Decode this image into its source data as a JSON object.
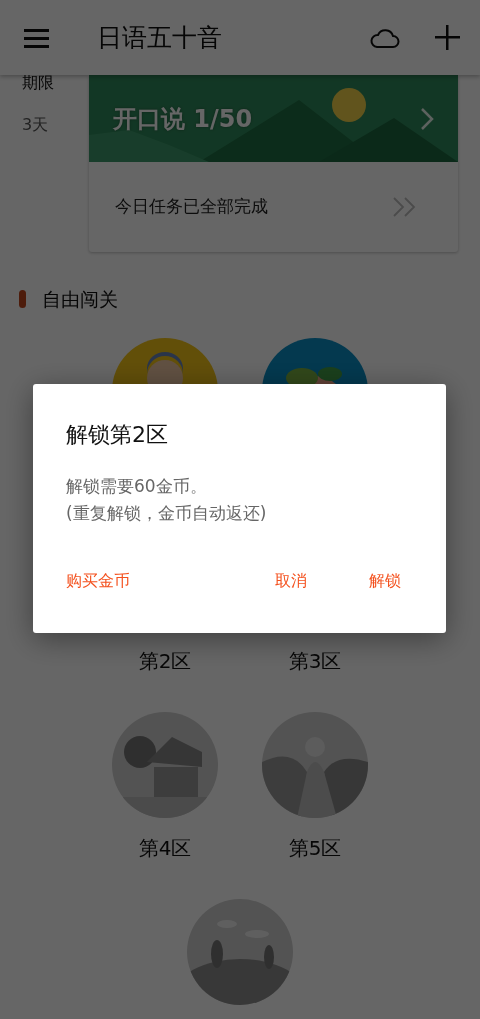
{
  "app_bar": {
    "title": "日语五十音"
  },
  "deadline": {
    "label": "期限",
    "value": "3天"
  },
  "speaking_card": {
    "title": "开口说 1/50",
    "task_status": "今日任务已全部完成"
  },
  "section": {
    "title": "自由闯关"
  },
  "zone_rows": [
    [
      {
        "kind": "portrait"
      },
      {
        "kind": "fruit"
      }
    ],
    [
      {
        "kind": "caption",
        "label": "第2区"
      },
      {
        "kind": "caption",
        "label": "第3区"
      }
    ],
    [
      {
        "kind": "village",
        "label": "第4区"
      },
      {
        "kind": "valley",
        "label": "第5区"
      }
    ],
    [
      {
        "kind": "hills"
      }
    ]
  ],
  "dialog": {
    "title": "解锁第2区",
    "message": [
      "解锁需要60金币。",
      "(重复解锁，金币自动返还)"
    ],
    "buttons": [
      {
        "kind": "left",
        "label": "购买金币"
      },
      {
        "kind": "right",
        "label": "取消"
      },
      {
        "kind": "right",
        "label": "解锁"
      }
    ]
  }
}
